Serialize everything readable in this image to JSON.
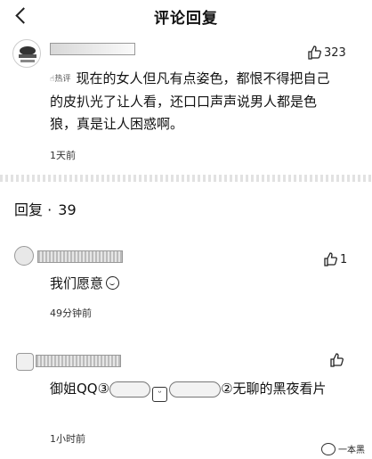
{
  "header": {
    "title": "评论回复"
  },
  "main_comment": {
    "hot_tag": "热评",
    "text": "现在的女人但凡有点姿色，都恨不得把自己的皮扒光了让人看，还口口声声说男人都是色狼，真是让人困惑啊。",
    "likes": "323",
    "time": "1天前"
  },
  "replies_header": {
    "label": "回复",
    "separator": "·",
    "count": "39"
  },
  "replies": [
    {
      "text": "我们愿意",
      "likes": "1",
      "time": "49分钟前"
    },
    {
      "text_prefix": "御姐QQ③",
      "text_mid": "②无聊的黑夜看片",
      "likes": "",
      "time": "1小时前"
    }
  ],
  "watermark": {
    "label": "一本黑"
  },
  "icons": {
    "back": "back-arrow-icon",
    "like": "thumbs-up-icon",
    "emoji": "smile-emoji-icon"
  }
}
